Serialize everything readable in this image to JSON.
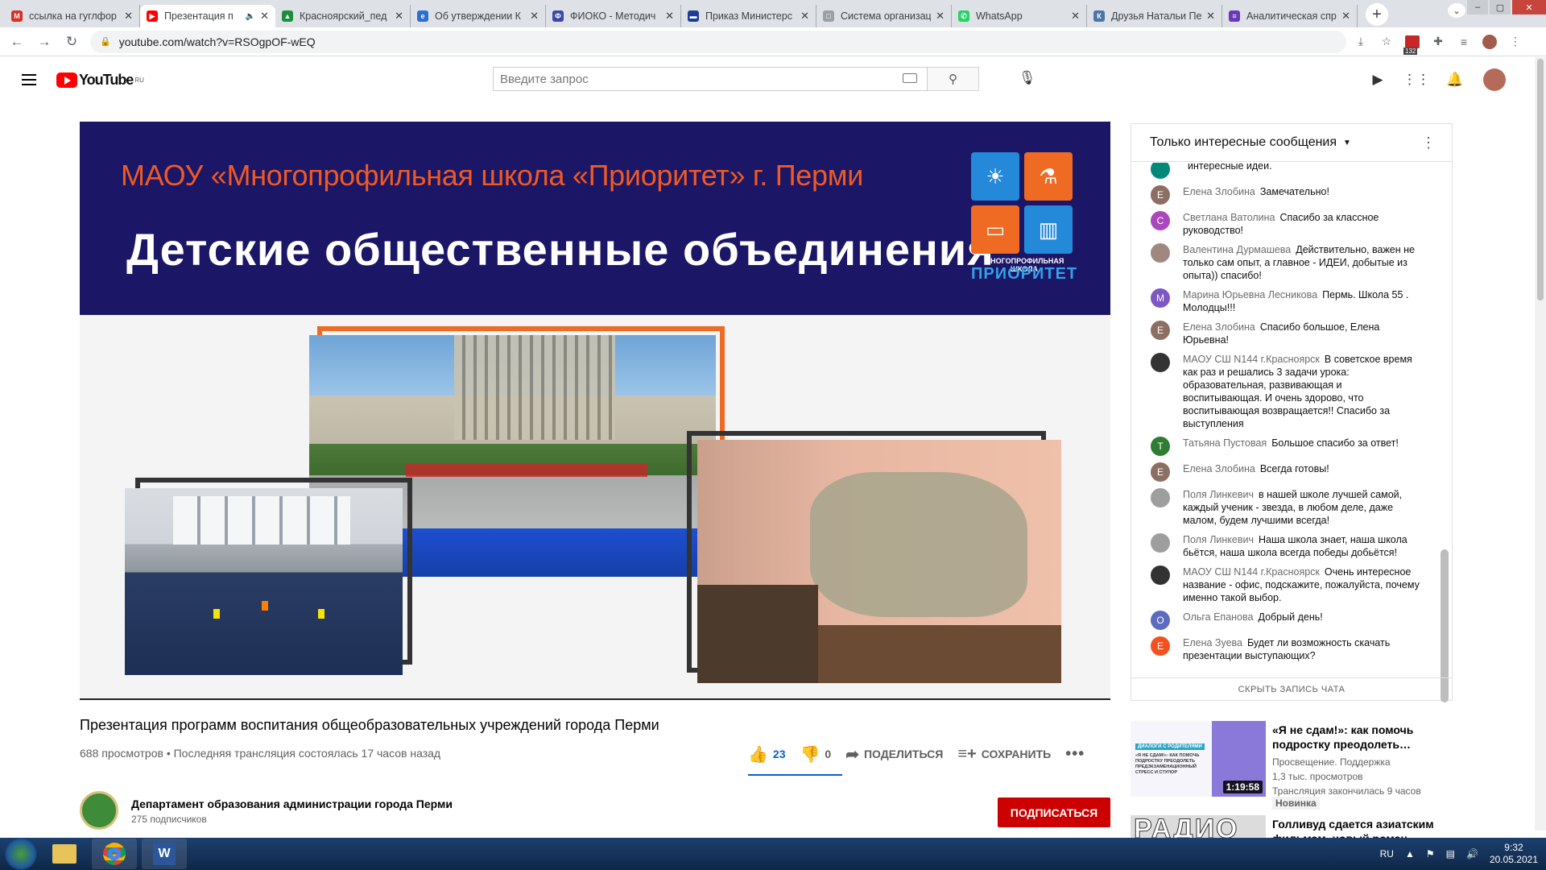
{
  "browser": {
    "tabs": [
      {
        "label": "ссылка на гуглфор",
        "icon": "gmail-icon",
        "color": "#d93025",
        "letter": "M"
      },
      {
        "label": "Презентация п",
        "icon": "youtube-icon",
        "color": "#ff0000",
        "letter": "▶",
        "active": true
      },
      {
        "label": "Красноярский_пед",
        "icon": "google-drive-icon",
        "color": "#1e8e3e",
        "letter": "▲"
      },
      {
        "label": "Об утверждении К",
        "icon": "edge-icon",
        "color": "#2b6ed4",
        "letter": "e"
      },
      {
        "label": "ФИОКО - Методич",
        "icon": "fioko-icon",
        "color": "#3b4aa8",
        "letter": "Ф"
      },
      {
        "label": "Приказ Министерс",
        "icon": "russia-flag-icon",
        "color": "#1c3f94",
        "letter": "▬"
      },
      {
        "label": "Система организац",
        "icon": "document-icon",
        "color": "#9aa0a6",
        "letter": "□"
      },
      {
        "label": "WhatsApp",
        "icon": "whatsapp-icon",
        "color": "#25d366",
        "letter": "✆"
      },
      {
        "label": "Друзья Натальи Пе",
        "icon": "vk-icon",
        "color": "#4a76a8",
        "letter": "К"
      },
      {
        "label": "Аналитическая спр",
        "icon": "forms-icon",
        "color": "#673ab7",
        "letter": "≡"
      }
    ],
    "url": "youtube.com/watch?v=RSOgpOF-wEQ",
    "ext_badge": "132"
  },
  "yt": {
    "logo_text": "YouTube",
    "region": "RU",
    "search_placeholder": "Введите запрос"
  },
  "slide": {
    "school": "МАОУ «Многопрофильная школа «Приоритет» г. Перми",
    "title": "Детские общественные объединения",
    "logo_line1": "МНОГОПРОФИЛЬНАЯ ШКОЛА",
    "logo_line2": "ПРИОРИТЕТ"
  },
  "video": {
    "title": "Презентация программ воспитания общеобразовательных учреждений города Перми",
    "meta": "688 просмотров • Последняя трансляция состоялась 17 часов назад",
    "likes": "23",
    "dislikes": "0",
    "share": "ПОДЕЛИТЬСЯ",
    "save": "СОХРАНИТЬ",
    "more": "•••"
  },
  "channel": {
    "name": "Департамент образования администрации города Перми",
    "subs": "275 подписчиков",
    "subscribe": "ПОДПИСАТЬСЯ"
  },
  "chat": {
    "header": "Только интересные сообщения",
    "hide": "СКРЫТЬ ЗАПИСЬ ЧАТА",
    "messages": [
      {
        "author": "",
        "text": "интересные идеи.",
        "letter": "",
        "color": "#00897b"
      },
      {
        "author": "Елена Злобина",
        "text": "Замечательно!",
        "letter": "Е",
        "color": "#8d6e63"
      },
      {
        "author": "Светлана Ватолина",
        "text": "Спасибо за классное руководство!",
        "letter": "С",
        "color": "#ab47bc"
      },
      {
        "author": "Валентина Дурмашева",
        "text": "Действительно, важен не только сам опыт, а главное - ИДЕИ, добытые из опыта)) спасибо!",
        "letter": "",
        "color": "#a1887f"
      },
      {
        "author": "Марина Юрьевна Лесникова",
        "text": "Пермь. Школа 55 . Молодцы!!!",
        "letter": "М",
        "color": "#7e57c2"
      },
      {
        "author": "Елена Злобина",
        "text": "Спасибо большое, Елена Юрьевна!",
        "letter": "Е",
        "color": "#8d6e63"
      },
      {
        "author": "МАОУ СШ N144 г.Красноярск",
        "text": "В советское время как раз и решались 3 задачи урока: образовательная, развивающая и воспитывающая. И очень здорово, что воспитывающая возвращается!! Спасибо за выступления",
        "letter": "",
        "color": "#333333"
      },
      {
        "author": "Татьяна Пустовая",
        "text": "Большое спасибо за ответ!",
        "letter": "Т",
        "color": "#2e7d32"
      },
      {
        "author": "Елена Злобина",
        "text": "Всегда готовы!",
        "letter": "Е",
        "color": "#8d6e63"
      },
      {
        "author": "Поля Линкевич",
        "text": "в нашей школе лучшей самой, каждый ученик - звезда, в любом деле, даже малом, будем лучшими всегда!",
        "letter": "",
        "color": "#9e9e9e"
      },
      {
        "author": "Поля Линкевич",
        "text": "Наша школа знает, наша школа бьётся, наша школа всегда победы добьётся!",
        "letter": "",
        "color": "#9e9e9e"
      },
      {
        "author": "МАОУ СШ N144 г.Красноярск",
        "text": "Очень интересное название - офис, подскажите, пожалуйста, почему именно такой выбор.",
        "letter": "",
        "color": "#333333"
      },
      {
        "author": "Ольга Епанова",
        "text": "Добрый день!",
        "letter": "О",
        "color": "#5c6bc0"
      },
      {
        "author": "Елена Зуева",
        "text": "Будет ли возможность скачать презентации выступающих?",
        "letter": "Е",
        "color": "#f4511e"
      }
    ]
  },
  "recs": [
    {
      "title": "«Я не сдам!»: как помочь подростку преодолеть…",
      "channel": "Просвещение. Поддержка",
      "views": "1,3 тыс. просмотров",
      "status": "Трансляция закончилась 9 часов",
      "badge": "Новинка",
      "duration": "1:19:58",
      "thumb_text": "«Я НЕ СДАМ!»: КАК ПОМОЧЬ ПОДРОСТКУ ПРЕОДОЛЕТЬ ПРЕДЭКЗАМЕНАЦИОННЫЙ СТРЕСС И СТУПОР",
      "thumb_tag": "ДИАЛОГИ С РОДИТЕЛЯМИ"
    },
    {
      "title": "Голливуд сдается азиатским фильмам, новый роман…",
      "thumb_text": "РАДИО"
    }
  ],
  "taskbar": {
    "lang": "RU",
    "time": "9:32",
    "date": "20.05.2021"
  }
}
